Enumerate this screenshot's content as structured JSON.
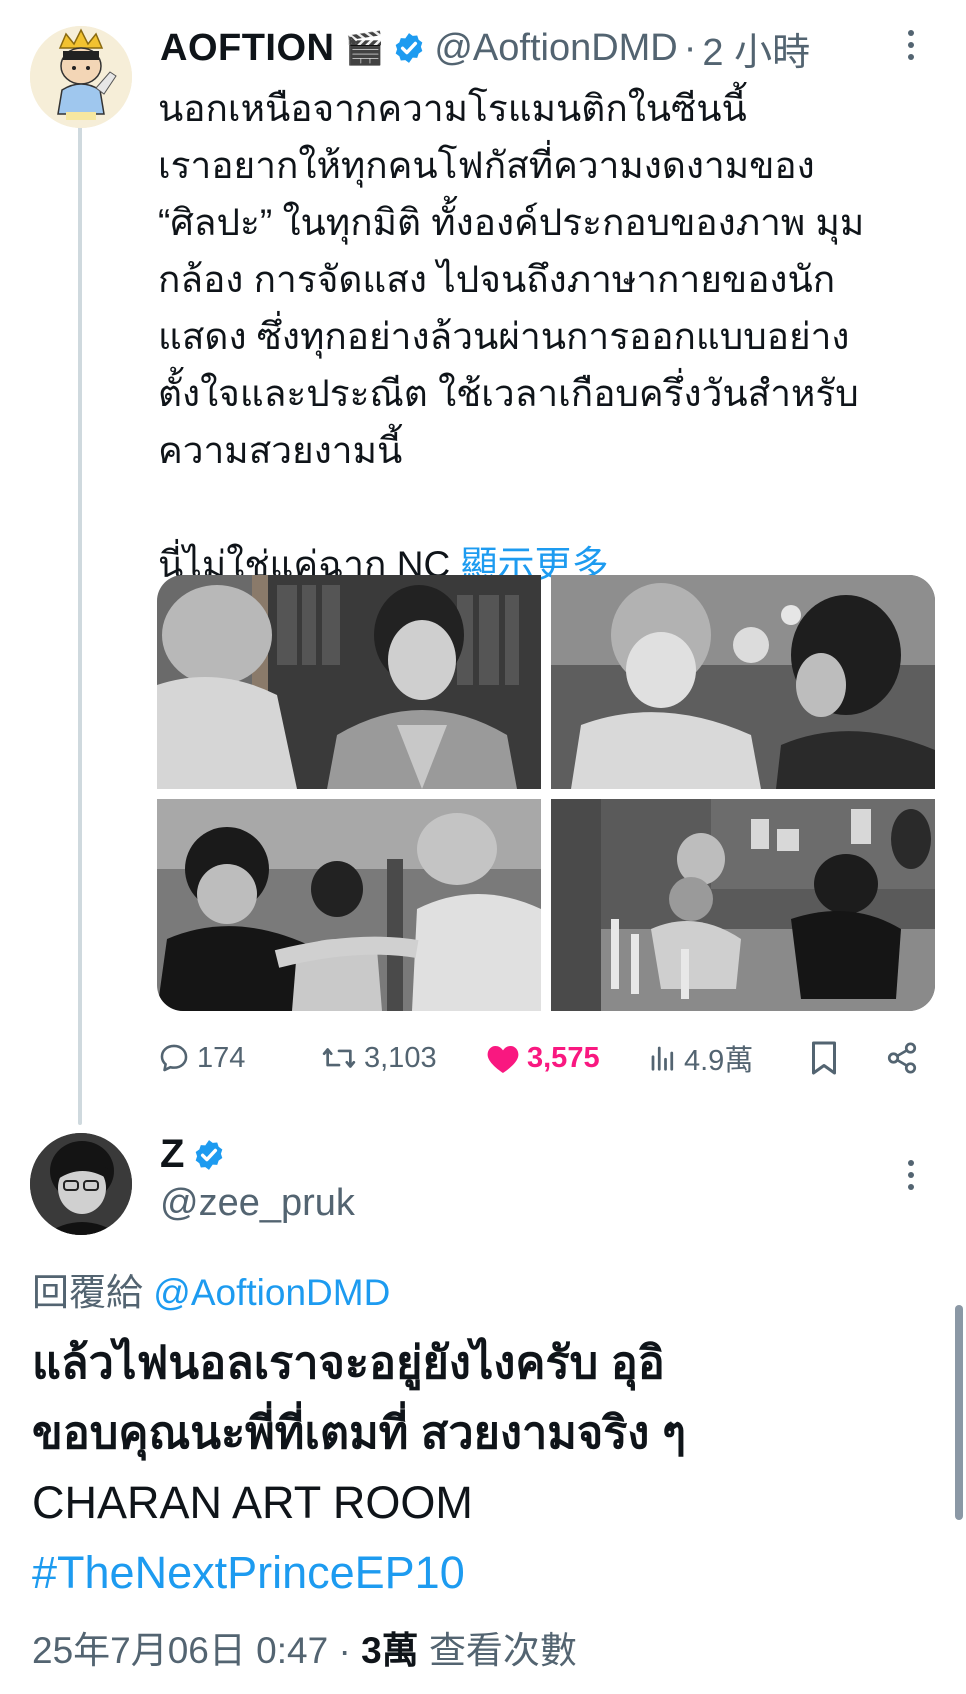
{
  "tweet": {
    "display_name": "AOFTION",
    "name_emoji": "🎬",
    "handle": "@AoftionDMD",
    "time": "2 小時",
    "body_lines": [
      "นอกเหนือจากความโรแมนติกในซีนนี้",
      "เราอยากให้ทุกคนโฟกัสที่ความงดงามของ",
      "“ศิลปะ” ในทุกมิติ ทั้งองค์ประกอบของภาพ มุม",
      "กล้อง การจัดแสง ไปจนถึงภาษากายของนัก",
      "แสดง ซึ่งทุกอย่างล้วนผ่านการออกแบบอย่าง",
      "ตั้งใจและประณีต ใช้เวลาเกือบครึ่งวันสำหรับ",
      "ความสวยงามนี้"
    ],
    "last_line": "นี่ไม่ใช่แค่ฉาก NC",
    "show_more": "顯示更多",
    "stats": {
      "replies": "174",
      "retweets": "3,103",
      "likes": "3,575",
      "views": "4.9萬"
    }
  },
  "reply": {
    "display_name": "Z",
    "handle": "@zee_pruk",
    "replying_label": "回覆給",
    "replying_to": "@AoftionDMD",
    "body_lines": [
      "แล้วไฟนอลเราจะอยู่ยังไงครับ อุอิ",
      "ขอบคุณนะพี่ที่เตมที่ สวยงามจริง ๆ",
      "CHARAN ART ROOM"
    ],
    "hashtag": "#TheNextPrinceEP10",
    "date": "25年7月06日 0:47",
    "views_count": "3萬",
    "views_label": "查看次數"
  },
  "colors": {
    "accent": "#1d9bf0",
    "like": "#f91880",
    "muted": "#536471",
    "text": "#0f1419"
  }
}
